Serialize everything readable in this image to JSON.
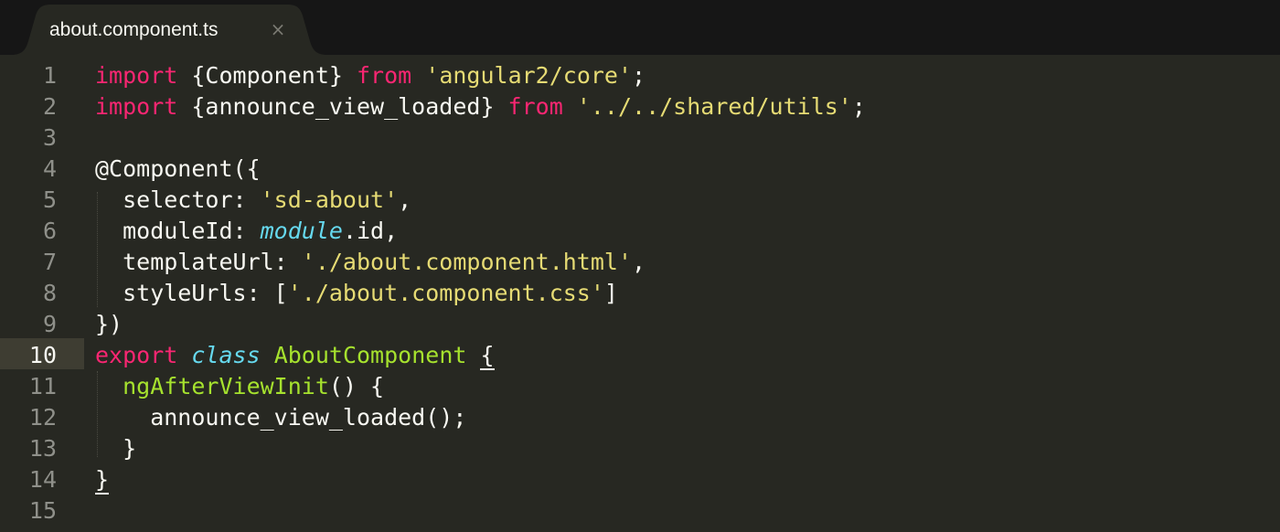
{
  "tab": {
    "title": "about.component.ts",
    "close_glyph": "×"
  },
  "colors": {
    "background": "#272822",
    "tabbar": "#161616",
    "keyword": "#f92672",
    "string": "#e6db74",
    "storage": "#66d9ef",
    "entity": "#a6e22e",
    "text": "#f8f8f2",
    "line_number": "#8f908a"
  },
  "active_line": 10,
  "line_numbers": [
    "1",
    "2",
    "3",
    "4",
    "5",
    "6",
    "7",
    "8",
    "9",
    "10",
    "11",
    "12",
    "13",
    "14",
    "15"
  ],
  "lines": [
    [
      [
        "kw",
        "import"
      ],
      [
        "pl",
        " {Component} "
      ],
      [
        "kw",
        "from"
      ],
      [
        "pl",
        " "
      ],
      [
        "str",
        "'angular2/core'"
      ],
      [
        "pl",
        ";"
      ]
    ],
    [
      [
        "kw",
        "import"
      ],
      [
        "pl",
        " {announce_view_loaded} "
      ],
      [
        "kw",
        "from"
      ],
      [
        "pl",
        " "
      ],
      [
        "str",
        "'../../shared/utils'"
      ],
      [
        "pl",
        ";"
      ]
    ],
    [],
    [
      [
        "pl",
        "@Component({"
      ]
    ],
    [
      [
        "pl",
        "  selector: "
      ],
      [
        "str",
        "'sd-about'"
      ],
      [
        "pl",
        ","
      ]
    ],
    [
      [
        "pl",
        "  moduleId: "
      ],
      [
        "sto",
        "module"
      ],
      [
        "pl",
        ".id,"
      ]
    ],
    [
      [
        "pl",
        "  templateUrl: "
      ],
      [
        "str",
        "'./about.component.html'"
      ],
      [
        "pl",
        ","
      ]
    ],
    [
      [
        "pl",
        "  styleUrls: ["
      ],
      [
        "str",
        "'./about.component.css'"
      ],
      [
        "pl",
        "]"
      ]
    ],
    [
      [
        "pl",
        "})"
      ]
    ],
    [
      [
        "kw",
        "export"
      ],
      [
        "pl",
        " "
      ],
      [
        "sto",
        "class"
      ],
      [
        "pl",
        " "
      ],
      [
        "cls",
        "AboutComponent"
      ],
      [
        "pl",
        " "
      ],
      [
        "brace-match",
        "{"
      ]
    ],
    [
      [
        "pl",
        "  "
      ],
      [
        "fn",
        "ngAfterViewInit"
      ],
      [
        "pl",
        "() {"
      ]
    ],
    [
      [
        "pl",
        "    announce_view_loaded();"
      ]
    ],
    [
      [
        "pl",
        "  }"
      ]
    ],
    [
      [
        "brace-match",
        "}"
      ]
    ],
    []
  ]
}
